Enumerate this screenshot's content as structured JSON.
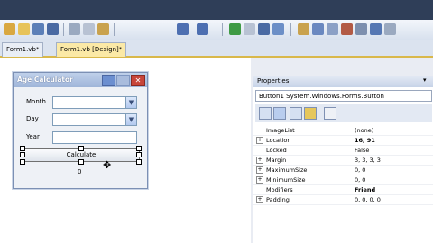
{
  "tabs": [
    {
      "label": "Form1.vb*"
    },
    {
      "label": "Form1.vb [Design]*"
    }
  ],
  "form": {
    "title": "Age Calculator",
    "month_label": "Month",
    "day_label": "Day",
    "year_label": "Year",
    "button_label": "Calculate",
    "result_text": "0"
  },
  "properties": {
    "title": "Properties",
    "selected_object": "Button1  System.Windows.Forms.Button",
    "rows": [
      {
        "name": "ImageList",
        "value": "(none)",
        "expandable": false
      },
      {
        "name": "Location",
        "value": "16, 91",
        "expandable": true
      },
      {
        "name": "Locked",
        "value": "False",
        "expandable": false
      },
      {
        "name": "Margin",
        "value": "3, 3, 3, 3",
        "expandable": true
      },
      {
        "name": "MaximumSize",
        "value": "0, 0",
        "expandable": true
      },
      {
        "name": "MinimumSize",
        "value": "0, 0",
        "expandable": true
      },
      {
        "name": "Modifiers",
        "value": "Friend",
        "expandable": false
      },
      {
        "name": "Padding",
        "value": "0, 0, 0, 0",
        "expandable": true
      }
    ]
  },
  "colors": {
    "accent_tab": "#fbe9a6",
    "title_bar": "#9fb5d9",
    "close_button": "#c8453a"
  }
}
